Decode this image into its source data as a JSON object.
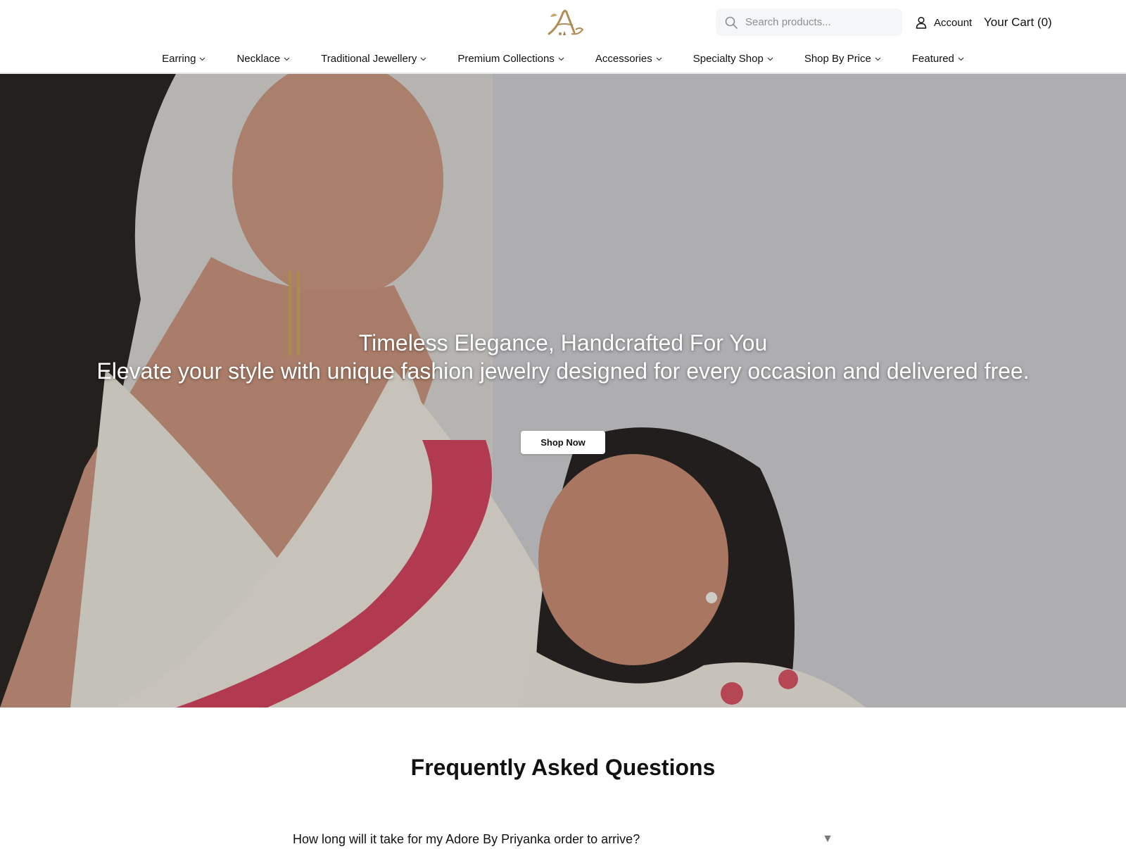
{
  "brand": {
    "logo_icon": "adore-logo-icon",
    "accent_color": "#b08d57"
  },
  "header": {
    "search_placeholder": "Search products...",
    "account_label": "Account",
    "cart_label": "Your Cart (0)"
  },
  "nav": {
    "items": [
      {
        "label": "Earring"
      },
      {
        "label": "Necklace"
      },
      {
        "label": "Traditional Jewellery"
      },
      {
        "label": "Premium Collections"
      },
      {
        "label": "Accessories"
      },
      {
        "label": "Specialty Shop"
      },
      {
        "label": "Shop By Price"
      },
      {
        "label": "Featured"
      }
    ]
  },
  "hero": {
    "title": "Timeless Elegance, Handcrafted For You",
    "subtitle": "Elevate your style with unique fashion jewelry designed for every occasion and delivered free.",
    "cta_label": "Shop Now"
  },
  "faq": {
    "title": "Frequently Asked Questions",
    "items": [
      {
        "question": "How long will it take for my Adore By Priyanka order to arrive?",
        "arrow": "▼"
      }
    ]
  }
}
